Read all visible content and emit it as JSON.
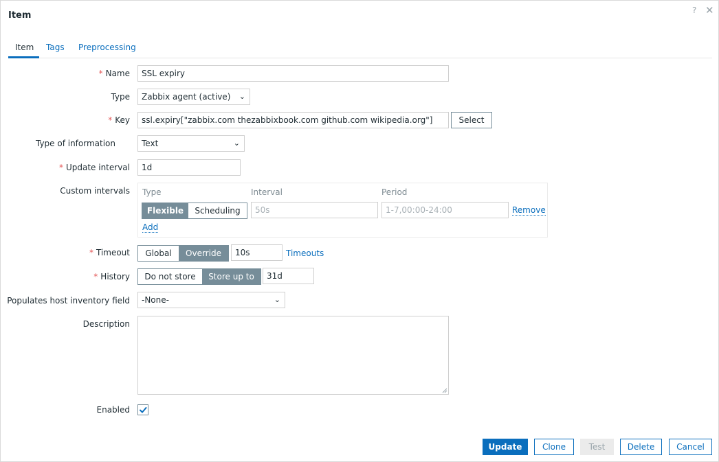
{
  "dialog": {
    "title": "Item",
    "help_glyph": "?",
    "close_glyph": "✕"
  },
  "tabs": [
    {
      "label": "Item",
      "active": true
    },
    {
      "label": "Tags",
      "active": false
    },
    {
      "label": "Preprocessing",
      "active": false
    }
  ],
  "form": {
    "name": {
      "label": "Name",
      "required": true,
      "value": "SSL expiry"
    },
    "type": {
      "label": "Type",
      "value": "Zabbix agent (active)"
    },
    "key": {
      "label": "Key",
      "required": true,
      "value": "ssl.expiry[\"zabbix.com thezabbixbook.com github.com wikipedia.org\"]",
      "select_label": "Select"
    },
    "type_of_information": {
      "label": "Type of information",
      "value": "Text"
    },
    "update_interval": {
      "label": "Update interval",
      "required": true,
      "value": "1d"
    },
    "custom_intervals": {
      "label": "Custom intervals",
      "headers": {
        "type": "Type",
        "interval": "Interval",
        "period": "Period"
      },
      "row": {
        "options": [
          "Flexible",
          "Scheduling"
        ],
        "selected": "Flexible",
        "interval_placeholder": "50s",
        "period_placeholder": "1-7,00:00-24:00",
        "remove_label": "Remove"
      },
      "add_label": "Add"
    },
    "timeout": {
      "label": "Timeout",
      "required": true,
      "options": [
        "Global",
        "Override"
      ],
      "selected": "Override",
      "value": "10s",
      "link_label": "Timeouts"
    },
    "history": {
      "label": "History",
      "required": true,
      "options": [
        "Do not store",
        "Store up to"
      ],
      "selected": "Store up to",
      "value": "31d"
    },
    "inventory": {
      "label": "Populates host inventory field",
      "value": "-None-"
    },
    "description": {
      "label": "Description",
      "value": ""
    },
    "enabled": {
      "label": "Enabled",
      "checked": true
    }
  },
  "footer": {
    "update": "Update",
    "clone": "Clone",
    "test": "Test",
    "delete": "Delete",
    "cancel": "Cancel"
  },
  "colors": {
    "link": "#0a6ebd",
    "required": "#e45959",
    "segment_active": "#768d99"
  }
}
